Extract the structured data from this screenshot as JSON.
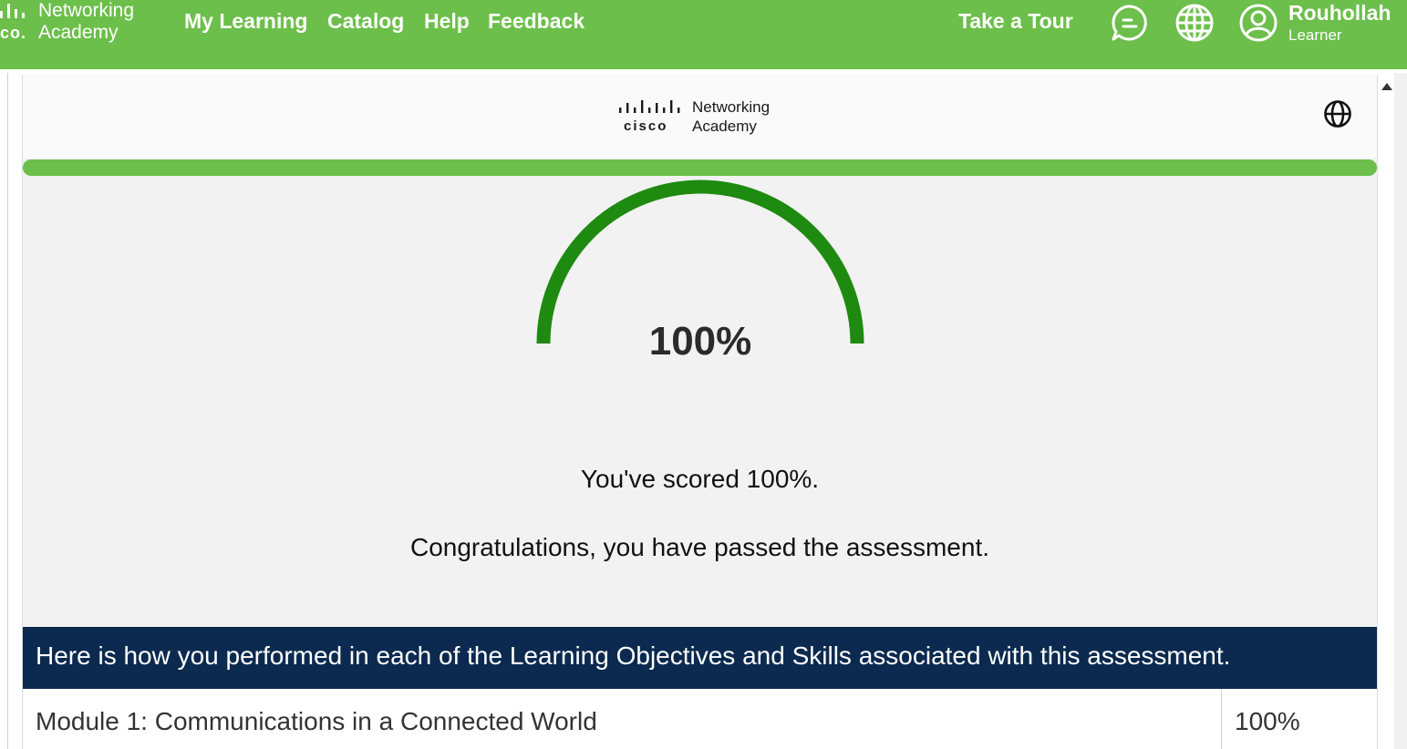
{
  "app": {
    "logo_line1": "Networking",
    "logo_line2": "Academy",
    "logo_fragment": "co."
  },
  "nav": {
    "items": [
      {
        "label": "My Learning"
      },
      {
        "label": "Catalog"
      },
      {
        "label": "Help"
      },
      {
        "label": "Feedback"
      }
    ],
    "take_tour": "Take a Tour"
  },
  "header_icons": [
    "chat-icon",
    "globe-icon",
    "user-avatar-icon"
  ],
  "user": {
    "name": "Rouhollah",
    "role": "Learner"
  },
  "module_header": {
    "logo_text": "cisco",
    "logo_line1": "Networking",
    "logo_line2": "Academy",
    "icon": "globe-icon"
  },
  "result": {
    "score_percent": 100,
    "score_label": "100%",
    "progress_fraction": 1.0,
    "message_score": "You've scored 100%.",
    "message_passed": "Congratulations, you have passed the assessment."
  },
  "performance": {
    "heading": "Here is how you performed in each of the Learning Objectives and Skills associated with this assessment.",
    "rows": [
      {
        "module": "Module 1: Communications in a Connected World",
        "score": "100%"
      }
    ]
  },
  "colors": {
    "brand_green": "#6cbf4a",
    "gauge_green": "#1e8a10",
    "banner_navy": "#0c2a4f",
    "frame_bg": "#f2f2f2"
  }
}
